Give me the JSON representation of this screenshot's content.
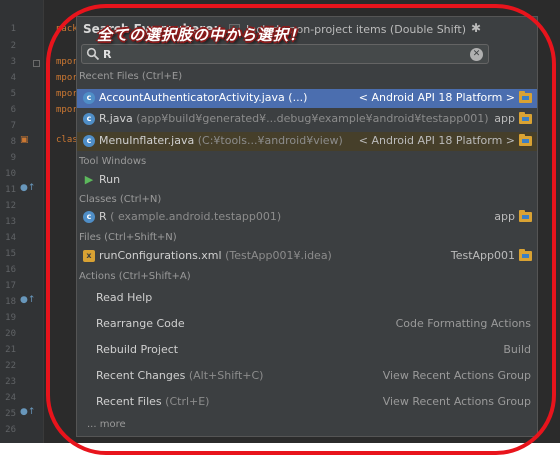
{
  "popup": {
    "title": "Search Everywhere:",
    "include_label": "Include non-project items (Double Shift)",
    "search_value": "R",
    "banner": "全ての選択肢の中から選択！",
    "more": "... more"
  },
  "sections": {
    "recent_files": "Recent Files (Ctrl+E)",
    "tool_windows": "Tool Windows",
    "classes": "Classes (Ctrl+N)",
    "files": "Files (Ctrl+Shift+N)",
    "actions": "Actions (Ctrl+Shift+A)"
  },
  "recent_files": [
    {
      "name": "AccountAuthenticatorActivity.java",
      "path": "(...)",
      "location": "< Android API 18 Platform >"
    },
    {
      "name": "R.java",
      "path": "(app¥build¥generated¥...debug¥example¥android¥testapp001)",
      "location": "app"
    },
    {
      "name": "MenuInflater.java",
      "path": "(C:¥tools...¥android¥view)",
      "location": "< Android API 18 Platform >"
    }
  ],
  "tool_windows": [
    {
      "name": "Run"
    }
  ],
  "classes": [
    {
      "name": "R",
      "path": "( example.android.testapp001)",
      "location": "app"
    }
  ],
  "files": [
    {
      "name": "runConfigurations.xml",
      "path": "(TestApp001¥.idea)",
      "location": "TestApp001"
    }
  ],
  "actions": [
    {
      "label": "Read Help",
      "hint": "",
      "group": ""
    },
    {
      "label": "Rearrange Code",
      "hint": "",
      "group": "Code Formatting Actions"
    },
    {
      "label": "Rebuild Project",
      "hint": "",
      "group": "Build"
    },
    {
      "label": "Recent Changes",
      "hint": "(Alt+Shift+C)",
      "group": "View Recent Actions Group"
    },
    {
      "label": "Recent Files",
      "hint": "(Ctrl+E)",
      "group": "View Recent Actions Group"
    }
  ],
  "editor": {
    "line_numbers": [
      "1",
      "2",
      "3",
      "4",
      "5",
      "6",
      "7",
      "8",
      "9",
      "10",
      "11",
      "12",
      "13",
      "14",
      "15",
      "16",
      "17",
      "18",
      "19",
      "20",
      "21",
      "22",
      "23",
      "24",
      "25",
      "26"
    ],
    "code_fragments": [
      "pack",
      "mpor",
      "mpor",
      "mpor",
      "mpor",
      "class"
    ]
  },
  "colors": {
    "selection": "#4b6eaf",
    "highlight_row": "#463f2a",
    "annotation_outline": "#e8141c",
    "folder": "#d9a233"
  }
}
